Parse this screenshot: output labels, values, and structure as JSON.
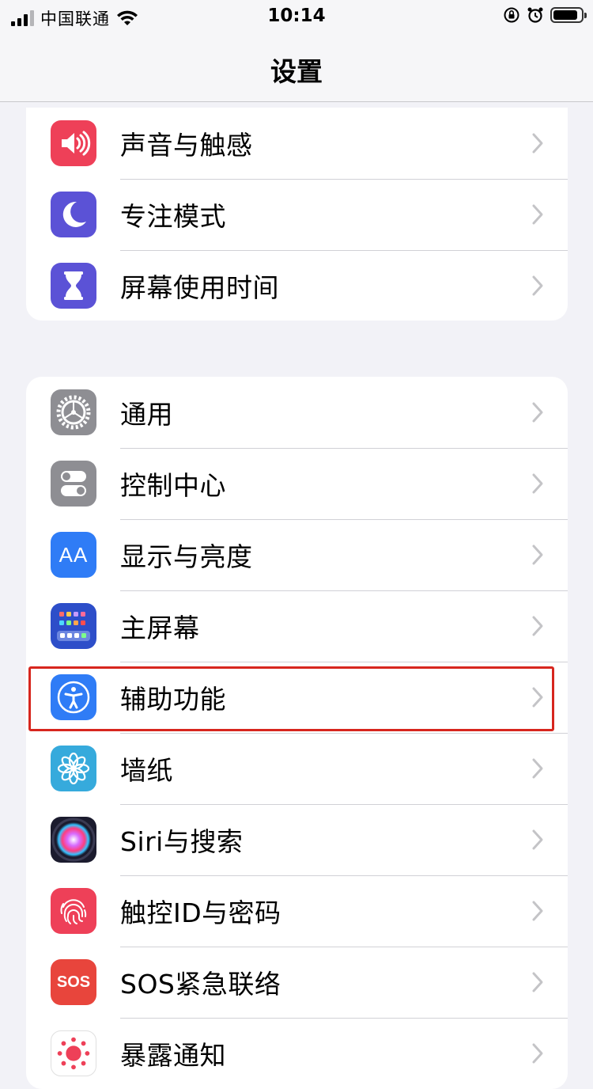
{
  "status_bar": {
    "carrier": "中国联通",
    "time": "10:14"
  },
  "nav": {
    "title": "设置"
  },
  "group1": [
    {
      "label": "声音与触感",
      "icon": "speaker-icon",
      "color": "#ee4058"
    },
    {
      "label": "专注模式",
      "icon": "moon-icon",
      "color": "#5b52d6"
    },
    {
      "label": "屏幕使用时间",
      "icon": "hourglass-icon",
      "color": "#5b52d6"
    }
  ],
  "group2": [
    {
      "label": "通用",
      "icon": "gear-icon",
      "color": "#8e8e93"
    },
    {
      "label": "控制中心",
      "icon": "toggles-icon",
      "color": "#8e8e93"
    },
    {
      "label": "显示与亮度",
      "icon": "text-size-icon",
      "color": "#2f7cf6"
    },
    {
      "label": "主屏幕",
      "icon": "home-grid-icon",
      "color": "#2d4ec9"
    },
    {
      "label": "辅助功能",
      "icon": "accessibility-icon",
      "color": "#2f7cf6"
    },
    {
      "label": "墙纸",
      "icon": "flower-icon",
      "color": "#36aadc"
    },
    {
      "label": "Siri与搜索",
      "icon": "siri-icon",
      "color": "#1b1b2e"
    },
    {
      "label": "触控ID与密码",
      "icon": "fingerprint-icon",
      "color": "#ee4058"
    },
    {
      "label": "SOS紧急联络",
      "icon": "sos-icon",
      "color": "#e8453c"
    },
    {
      "label": "暴露通知",
      "icon": "exposure-icon",
      "color": "#ffffff"
    }
  ],
  "icon_text": {
    "aa": "AA",
    "sos": "SOS"
  },
  "highlight_color": "#d7261e"
}
